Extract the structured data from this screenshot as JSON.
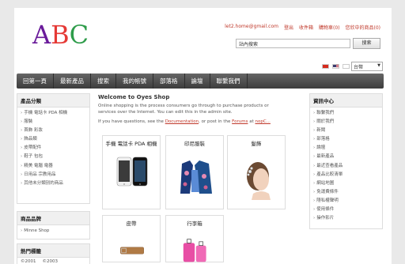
{
  "header": {
    "logo": [
      "A",
      "B",
      "C"
    ],
    "logo_colors": [
      "#6a1b9a",
      "#e53935",
      "#2e9c4a"
    ],
    "links": [
      "let2.home@gmail.com",
      "登出",
      "收件箱",
      "購物車(0)",
      "您欣中的商品(0)"
    ],
    "search_placeholder": "站內搜索",
    "search_button": "搜索",
    "currency": "台幣"
  },
  "nav": {
    "items": [
      "回第一頁",
      "最新產品",
      "搜索",
      "我的帳號",
      "部落格",
      "論壇",
      "聯繫我們"
    ]
  },
  "left_sidebar": {
    "categories_title": "產品分類",
    "categories": [
      "手機 電話卡 PDA 相機",
      "服裝",
      "首飾 彩妝",
      "飾品類",
      "皮帶配件",
      "鞋子 包包",
      "精美 電腦 電器",
      "日用品 宗教用品",
      "其他未分類別的商品"
    ],
    "manufacturers_title": "商品品牌",
    "manufacturers": [
      "Minne Shop"
    ],
    "tags_title": "熱門標籤",
    "tags": [
      "©2001",
      "©2003"
    ]
  },
  "main": {
    "welcome_title": "Welcome to Oyes Shop",
    "para1": "Online shopping is the process consumers go through to purchase products or services over the Internet. You can edit this in the admin site.",
    "para2_prefix": "If you have questions, see the ",
    "para2_link1": "Documentation",
    "para2_middle": ", or post in the ",
    "para2_link2": "Forums",
    "para2_middle2": " at ",
    "para2_link3": "nopC...",
    "categories": [
      {
        "title": "手機 電話卡 PDA 相機"
      },
      {
        "title": "印尼服裝"
      },
      {
        "title": "髮飾"
      },
      {
        "title": "皮帶"
      },
      {
        "title": "行李箱"
      }
    ]
  },
  "right_sidebar": {
    "title": "資訊中心",
    "items": [
      "聯繫我們",
      "關於我們",
      "新聞",
      "部落格",
      "論壇",
      "最新產品",
      "最近查看產品",
      "產品比較清單",
      "網站地圖",
      "免運費條件",
      "隱私權聲明",
      "使用條件",
      "操作影片"
    ]
  }
}
